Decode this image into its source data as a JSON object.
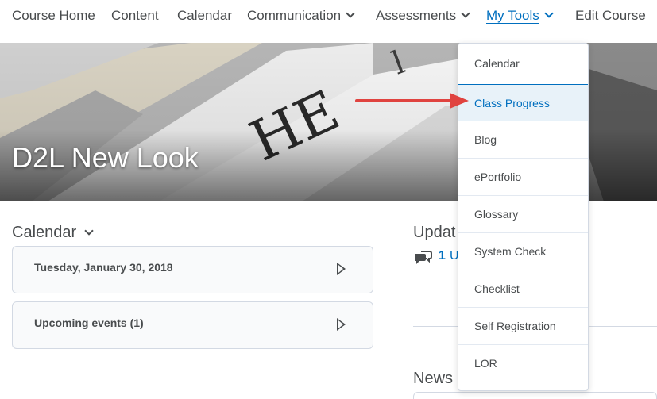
{
  "nav": {
    "items": [
      {
        "label": "Course Home"
      },
      {
        "label": "Content"
      },
      {
        "label": "Calendar"
      },
      {
        "label": "Communication"
      },
      {
        "label": "Assessments"
      },
      {
        "label": "My Tools"
      },
      {
        "label": "Edit Course"
      }
    ]
  },
  "banner": {
    "title": "D2L New Look"
  },
  "calendar": {
    "title": "Calendar",
    "today_label": "Tuesday, January 30, 2018",
    "upcoming_label": "Upcoming events (1)"
  },
  "updates": {
    "title": "Updat",
    "count": "1",
    "text": "U"
  },
  "news": {
    "title": "News"
  },
  "my_tools_menu": {
    "items": [
      {
        "label": "Calendar"
      },
      {
        "label": "Class Progress"
      },
      {
        "label": "Blog"
      },
      {
        "label": "ePortfolio"
      },
      {
        "label": "Glossary"
      },
      {
        "label": "System Check"
      },
      {
        "label": "Checklist"
      },
      {
        "label": "Self Registration"
      },
      {
        "label": "LOR"
      }
    ]
  },
  "colors": {
    "accent": "#006fbf",
    "text": "#494c4e",
    "annotation_arrow": "#e0433f"
  }
}
